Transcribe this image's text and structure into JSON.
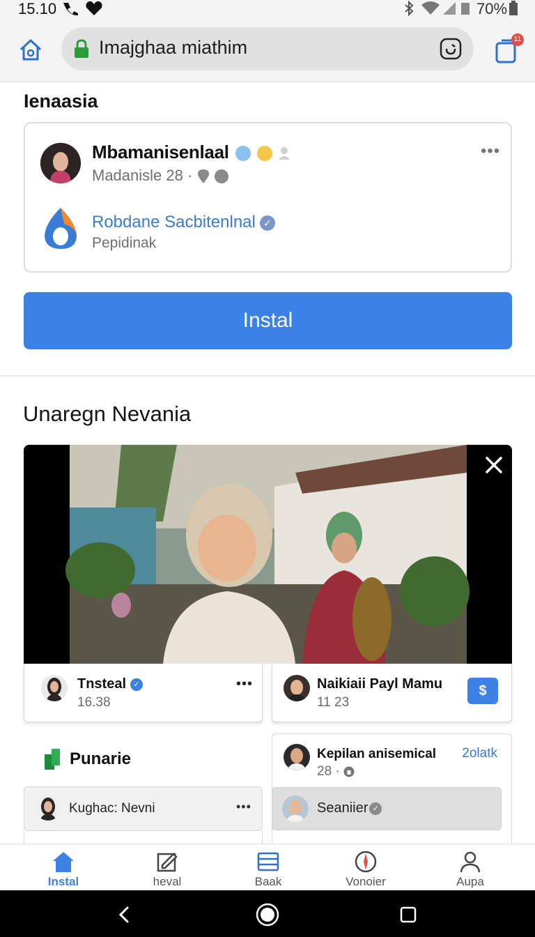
{
  "status_bar": {
    "time": "15.10",
    "battery": "70%"
  },
  "browser": {
    "url": "Imajghaa miathim",
    "tabs_count": "11",
    "icons": {
      "home": "home-icon",
      "lock": "lock-icon",
      "refresh": "refresh-icon",
      "tabs": "tabs-icon"
    }
  },
  "section1": {
    "title": "Ienaasia",
    "profile": {
      "name": "Mbamanisenlaal",
      "subtitle": "Madanisle 28 ·"
    },
    "page": {
      "name": "Robdane Sacbitenlnal",
      "subtitle": "Pepidinak"
    },
    "install_label": "Instal"
  },
  "section2": {
    "title": "Unaregn Nevania",
    "card_left": {
      "name": "Tnsteal",
      "time": "16.38"
    },
    "card_right": {
      "name": "Naikiaii Payl Mamu",
      "time": "11 23",
      "badge": "$"
    },
    "punarie_label": "Punarie",
    "row_left": {
      "name": "Kughac: Nevni"
    },
    "card_right2": {
      "name": "Kepilan anisemical",
      "sub": "28 ·",
      "link": "2olatk"
    },
    "row_right": {
      "name": "Seaniier"
    }
  },
  "bottom_nav": [
    {
      "label": "Instal",
      "icon": "home-icon",
      "active": true
    },
    {
      "label": "heval",
      "icon": "edit-icon",
      "active": false
    },
    {
      "label": "Baak",
      "icon": "list-icon",
      "active": false
    },
    {
      "label": "Vonoier",
      "icon": "compass-icon",
      "active": false
    },
    {
      "label": "Aupa",
      "icon": "profile-icon",
      "active": false
    }
  ],
  "colors": {
    "accent": "#3c82e6",
    "link": "#3a7bd5",
    "badge_red": "#e0504a"
  }
}
